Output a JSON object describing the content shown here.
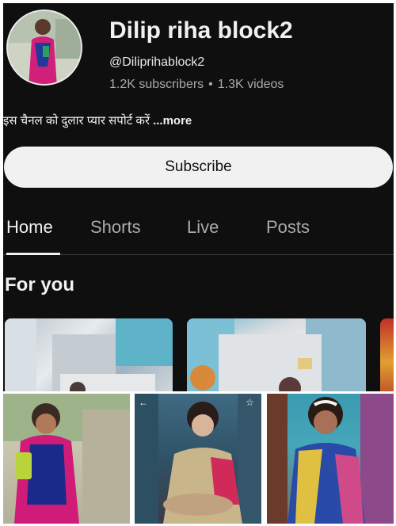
{
  "channel": {
    "name": "Dilip riha block2",
    "handle": "@Dilipriha​block2",
    "subscribers": "1.2K subscribers",
    "separator": "•",
    "videos": "1.3K videos",
    "description": "इस चैनल को दुलार प्यार सपोर्ट करें",
    "more_label": "...more"
  },
  "subscribe_label": "Subscribe",
  "tabs": [
    {
      "label": "Home",
      "active": true
    },
    {
      "label": "Shorts",
      "active": false
    },
    {
      "label": "Live",
      "active": false
    },
    {
      "label": "Posts",
      "active": false
    }
  ],
  "section_title": "For you",
  "thumbnail_icons": {
    "back": "←",
    "star": "☆"
  },
  "colors": {
    "background": "#0f0f0f",
    "text": "#f1f1f1",
    "secondary_text": "#aaaaaa",
    "button_bg": "#f1f1f1"
  }
}
